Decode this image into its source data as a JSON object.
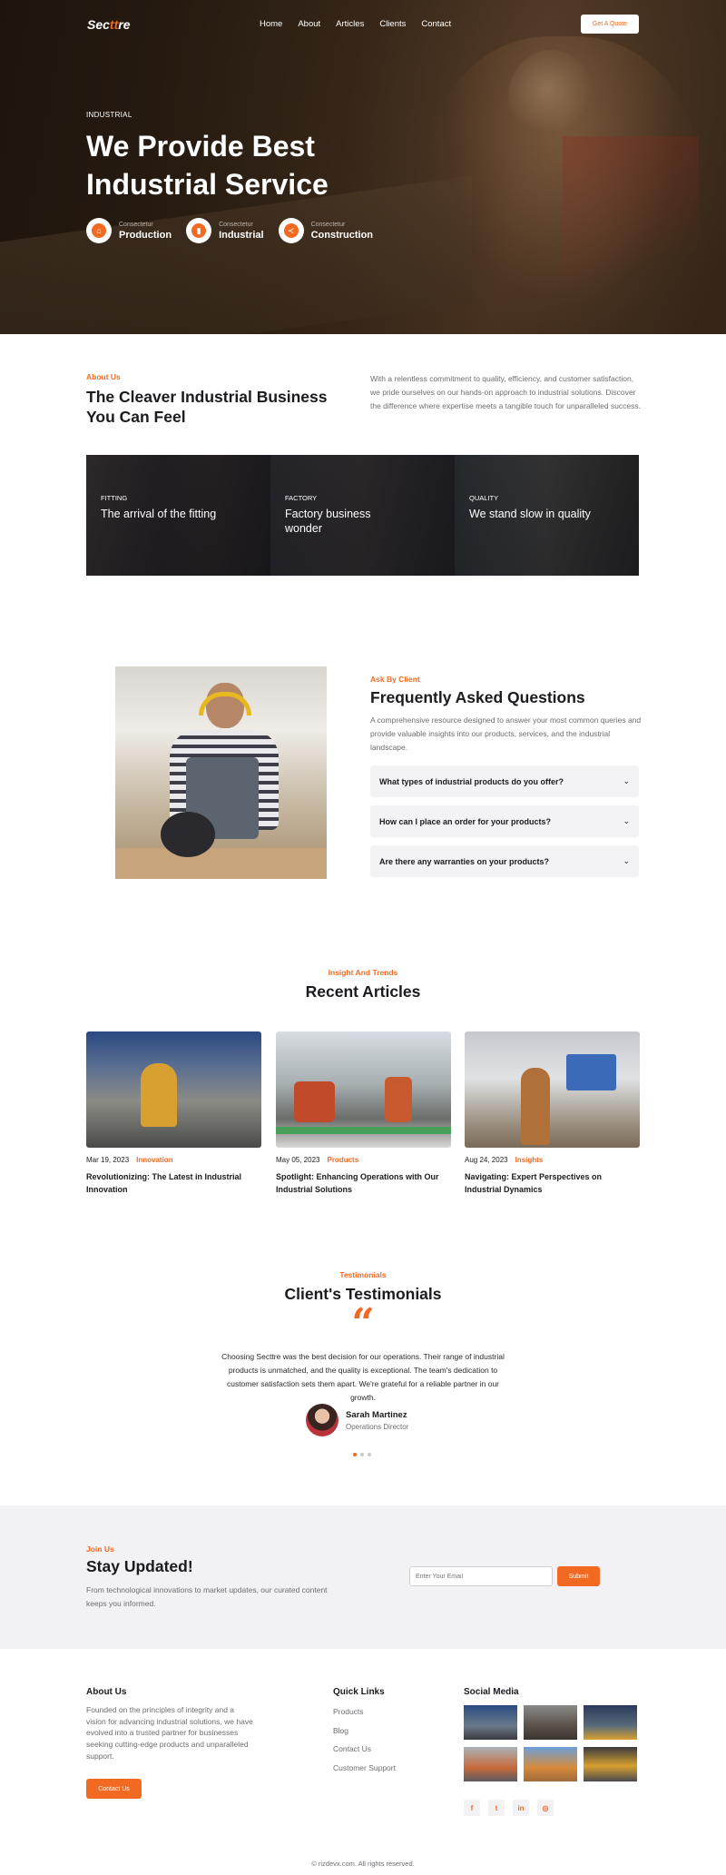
{
  "nav": {
    "logo_pre": "Sec",
    "logo_accent": "tt",
    "logo_post": "re",
    "links": [
      "Home",
      "About",
      "Articles",
      "Clients",
      "Contact"
    ],
    "quote_button": "Get A Quote"
  },
  "hero": {
    "kicker": "INDUSTRIAL",
    "title": "We Provide Best Industrial Service",
    "features": [
      {
        "sub": "Consectetur",
        "name": "Production",
        "icon": "factory-icon"
      },
      {
        "sub": "Consectetur",
        "name": "Industrial",
        "icon": "fuel-icon"
      },
      {
        "sub": "Consectetur",
        "name": "Construction",
        "icon": "share-icon"
      }
    ]
  },
  "about": {
    "kicker": "About Us",
    "title": "The Cleaver Industrial Business You Can Feel",
    "text": "With a relentless commitment to quality, efficiency, and customer satisfaction, we pride ourselves on our hands-on approach to industrial solutions. Discover the difference where expertise meets a tangible touch for unparalleled success.",
    "cards": [
      {
        "tag": "FITTING",
        "title": "The arrival of the fitting"
      },
      {
        "tag": "FACTORY",
        "title": "Factory business wonder"
      },
      {
        "tag": "QUALITY",
        "title": "We stand slow in quality"
      }
    ]
  },
  "faq": {
    "kicker": "Ask By Client",
    "title": "Frequently Asked Questions",
    "text": "A comprehensive resource designed to answer your most common queries and provide valuable insights into our products, services, and the industrial landscape.",
    "questions": [
      "What types of industrial products do you offer?",
      "How can I place an order for your products?",
      "Are there any warranties on your products?"
    ]
  },
  "articles": {
    "kicker": "Insight And Trends",
    "title": "Recent Articles",
    "items": [
      {
        "date": "Mar 19, 2023",
        "category": "Innovation",
        "title": "Revolutionizing: The Latest in Industrial Innovation"
      },
      {
        "date": "May 05, 2023",
        "category": "Products",
        "title": "Spotlight: Enhancing Operations with Our Industrial Solutions"
      },
      {
        "date": "Aug 24, 2023",
        "category": "Insights",
        "title": "Navigating: Expert Perspectives on Industrial Dynamics"
      }
    ]
  },
  "testimonials": {
    "kicker": "Testimonials",
    "title": "Client's Testimonials",
    "quote_mark": "“",
    "text": "Choosing Secttre was the best decision for our operations. Their range of industrial products is unmatched, and the quality is exceptional. The team's dedication to customer satisfaction sets them apart. We're grateful for a reliable partner in our growth.",
    "name": "Sarah Martinez",
    "role": "Operations Director"
  },
  "newsletter": {
    "kicker": "Join Us",
    "title": "Stay Updated!",
    "text": "From technological innovations to market updates, our curated content keeps you informed.",
    "placeholder": "Enter Your Email",
    "button": "Submit"
  },
  "footer": {
    "about_title": "About Us",
    "about_text": "Founded on the principles of integrity and a vision for advancing industrial solutions, we have evolved into a trusted partner for businesses seeking cutting-edge products and unparalleled support.",
    "contact_button": "Contact Us",
    "links_title": "Quick Links",
    "links": [
      "Products",
      "Blog",
      "Contact Us",
      "Customer Support"
    ],
    "social_title": "Social Media",
    "social": [
      {
        "glyph": "f",
        "icon": "facebook-icon"
      },
      {
        "glyph": "t",
        "icon": "twitter-icon"
      },
      {
        "glyph": "in",
        "icon": "linkedin-icon"
      },
      {
        "glyph": "◎",
        "icon": "instagram-icon"
      }
    ],
    "copyright": "© rizdevx.com. All rights reserved."
  },
  "colors": {
    "accent": "#f26a21",
    "dark": "#1b1b1f",
    "muted": "#6d6d72",
    "light_bg": "#f2f2f4"
  }
}
